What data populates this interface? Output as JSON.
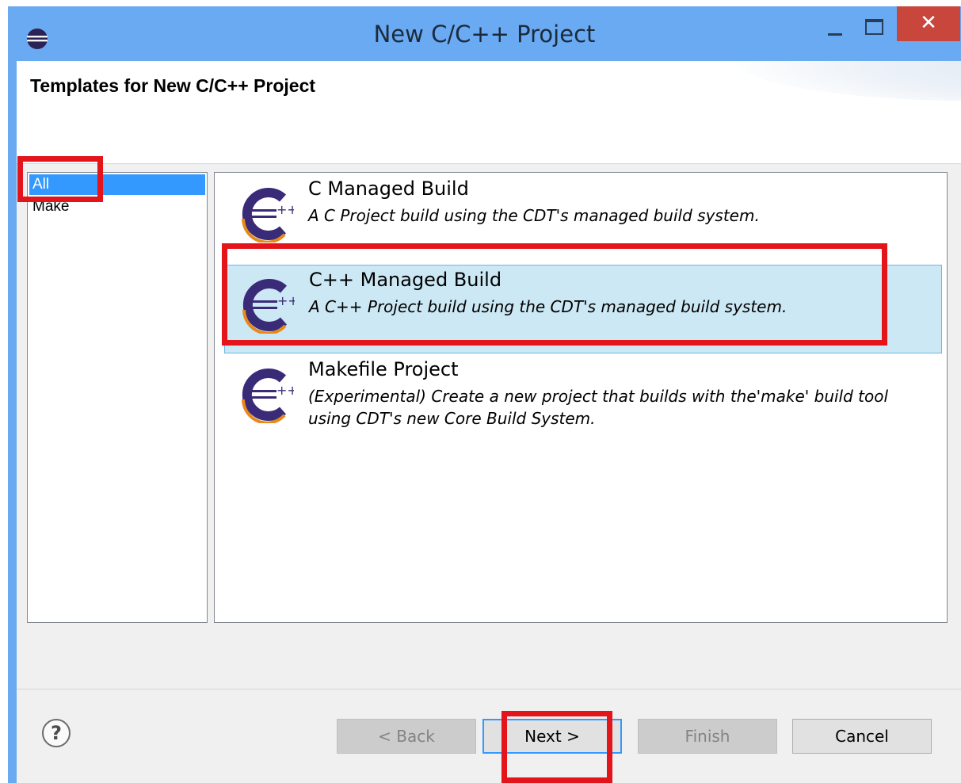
{
  "window": {
    "title": "New C/C++ Project"
  },
  "header": {
    "title": "Templates for New C/C++ Project"
  },
  "categories": [
    {
      "label": "All",
      "selected": true
    },
    {
      "label": "Make",
      "selected": false
    }
  ],
  "templates": [
    {
      "name": "C Managed Build",
      "description": "A C Project build using the CDT's managed build system.",
      "selected": false
    },
    {
      "name": "C++ Managed Build",
      "description": "A C++ Project build using the CDT's managed build system.",
      "selected": true
    },
    {
      "name": "Makefile Project",
      "description": "(Experimental) Create a new project that builds with the'make' build tool using CDT's new Core Build System.",
      "selected": false
    }
  ],
  "buttons": {
    "help": "?",
    "back": "< Back",
    "next": "Next >",
    "finish": "Finish",
    "cancel": "Cancel",
    "close": "✕"
  },
  "colors": {
    "title_bar": "#6aaaf2",
    "close_button": "#c9463d",
    "selection": "#3399ff",
    "template_selection": "#cce8f4",
    "annotation": "#e3151b",
    "cdt_icon_purple": "#3a2b78",
    "cdt_icon_orange": "#e88a1a"
  },
  "icons": {
    "app": "eclipse-icon",
    "template": "cdt-icon",
    "help": "help-icon"
  }
}
